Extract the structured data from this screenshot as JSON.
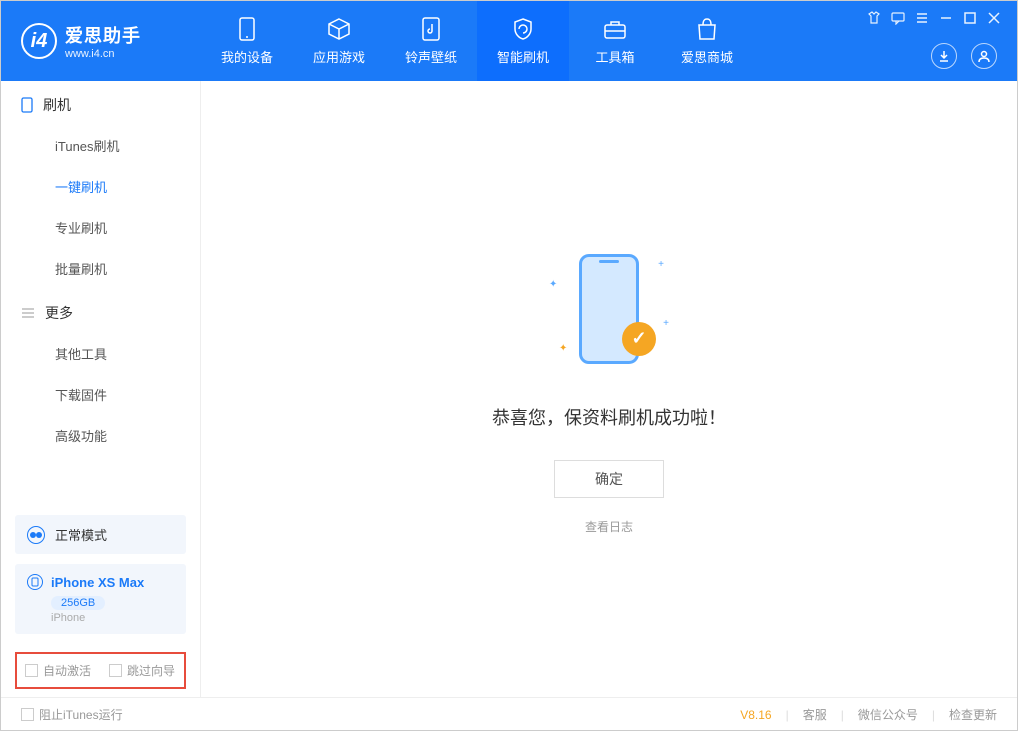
{
  "app": {
    "title": "爱思助手",
    "subtitle": "www.i4.cn"
  },
  "tabs": {
    "device": "我的设备",
    "apps": "应用游戏",
    "ringtone": "铃声壁纸",
    "flash": "智能刷机",
    "toolbox": "工具箱",
    "store": "爱思商城"
  },
  "sidebar": {
    "section1_title": "刷机",
    "section1_items": [
      "iTunes刷机",
      "一键刷机",
      "专业刷机",
      "批量刷机"
    ],
    "section2_title": "更多",
    "section2_items": [
      "其他工具",
      "下载固件",
      "高级功能"
    ]
  },
  "mode": {
    "label": "正常模式"
  },
  "device": {
    "name": "iPhone XS Max",
    "storage": "256GB",
    "type": "iPhone"
  },
  "options": {
    "auto_activate": "自动激活",
    "skip_guide": "跳过向导"
  },
  "main": {
    "success_text": "恭喜您，保资料刷机成功啦！",
    "ok_button": "确定",
    "view_log": "查看日志"
  },
  "footer": {
    "block_itunes": "阻止iTunes运行",
    "version": "V8.16",
    "service": "客服",
    "wechat": "微信公众号",
    "update": "检查更新"
  }
}
